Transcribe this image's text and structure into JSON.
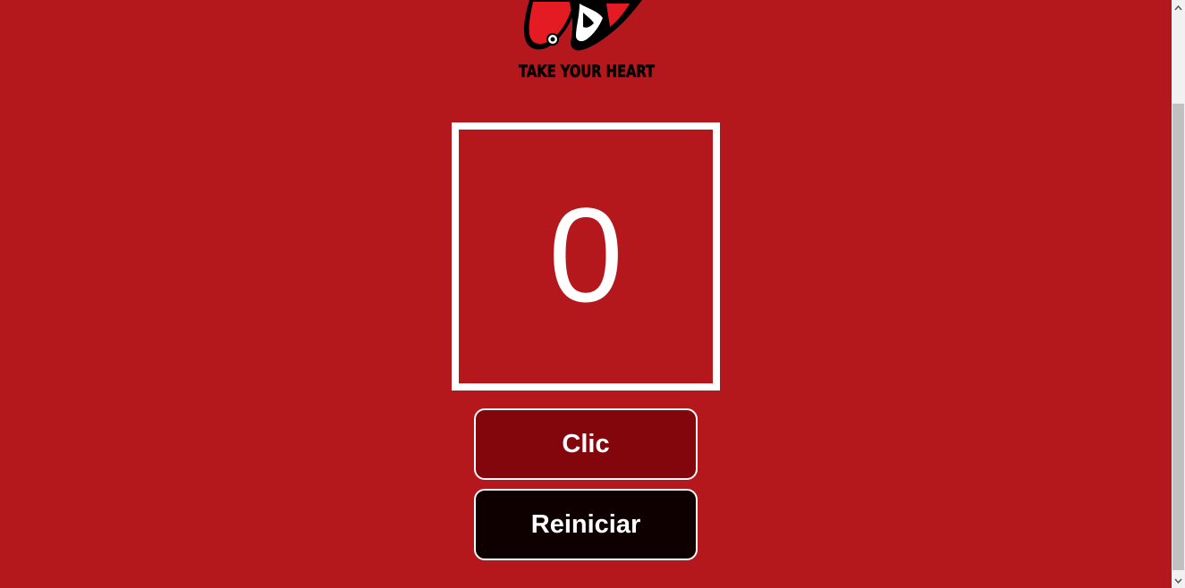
{
  "logo": {
    "tagline": "TAKE YOUR HEART",
    "icon": "phantom-thieves-calling-card-logo"
  },
  "counter": {
    "value": "0"
  },
  "buttons": {
    "click_label": "Clic",
    "reset_label": "Reiniciar"
  },
  "colors": {
    "background": "#b5181c",
    "click_button": "#83060c",
    "reset_button": "#0f0000",
    "text": "#ffffff"
  }
}
